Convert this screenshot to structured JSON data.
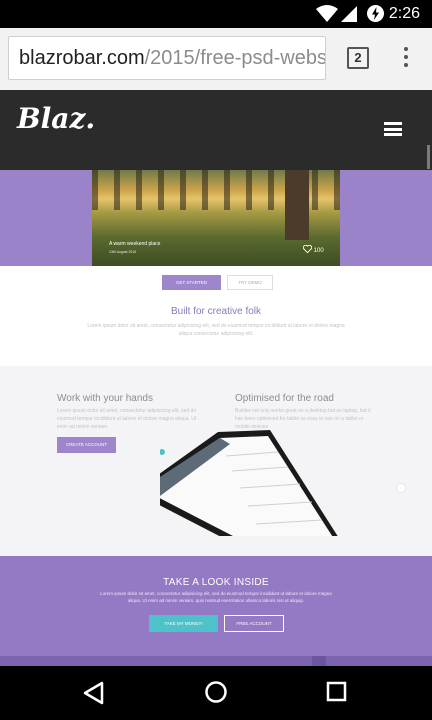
{
  "status_bar": {
    "time": "2:26"
  },
  "browser": {
    "url_host": "blazrobar.com",
    "url_path": "/2015/free-psd-webs",
    "tab_count": "2"
  },
  "site": {
    "logo": "Blaz.",
    "hero": {
      "caption": "A warm weekend place",
      "date": "13th August 2015",
      "likes": "100"
    },
    "buttons": {
      "get_started": "GET STARTED",
      "try_demo": "TRY DEMO"
    },
    "built_title": "Built for creative folk",
    "built_text": "Lorem ipsum dolor sit amet, consectetur adipisicing elit, sed do eiusmod tempor incididunt ut labore et dolore magna aliqua consectetur adipisicing elit.",
    "features": [
      {
        "title": "Work with your hands",
        "text": "Lorem ipsum dolor sit amet, consectetur adipisicing elit, sed do eiusmod tempor incididunt ut labore et dolore magna aliqua. Ut enim ad minim veniam"
      },
      {
        "title": "Optimised for the road",
        "text": "Builder not only works great on a desktop but on laptop, but it has been optimised for tablet as easy to use on a tablet or mobile devices"
      }
    ],
    "create_account": "CREATE ACCOUNT",
    "look": {
      "title": "TAKE A LOOK INSIDE",
      "text": "Lorem ipsum dolor sit amet, consectetur adipisicing elit, sed do eiusmod tempor incididunt ut labore et dolore magna aliqua. Ut enim ad minim veniam, quis nostrud exercitation ullamco laboris nisi ut aliquip.",
      "take_money": "TAKE MY MONEY!",
      "free_account": "FREE ACCOUNT"
    }
  },
  "colors": {
    "accent": "#9d86cc",
    "teal": "#4fc1c8",
    "header": "#2b2b2b"
  },
  "icons": [
    "wifi-icon",
    "signal-icon",
    "battery-charging-icon",
    "tab-switcher-icon",
    "overflow-menu-icon",
    "hamburger-menu-icon",
    "heart-icon",
    "back-icon",
    "home-icon",
    "recents-icon"
  ]
}
